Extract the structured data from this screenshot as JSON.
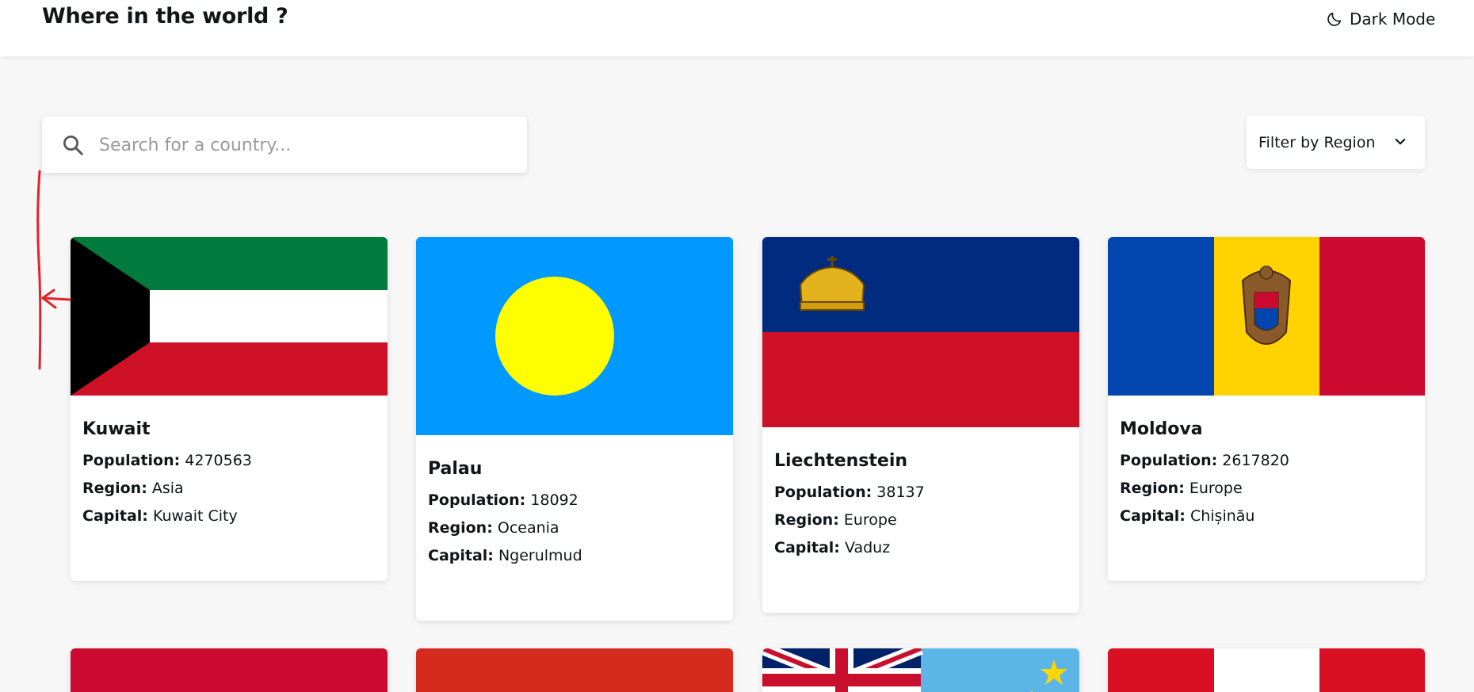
{
  "header": {
    "title": "Where in the world ?",
    "dark_mode_label": "Dark Mode",
    "dark_mode_icon": "moon-icon"
  },
  "search": {
    "placeholder": "Search for a country...",
    "value": "",
    "icon": "search-icon"
  },
  "filter": {
    "label": "Filter by Region",
    "icon": "chevron-down-icon"
  },
  "labels": {
    "population": "Population:",
    "region": "Region:",
    "capital": "Capital:"
  },
  "countries": [
    {
      "name": "Kuwait",
      "population": "4270563",
      "region": "Asia",
      "capital": "Kuwait City"
    },
    {
      "name": "Palau",
      "population": "18092",
      "region": "Oceania",
      "capital": "Ngerulmud"
    },
    {
      "name": "Liechtenstein",
      "population": "38137",
      "region": "Europe",
      "capital": "Vaduz"
    },
    {
      "name": "Moldova",
      "population": "2617820",
      "region": "Europe",
      "capital": "Chișinău"
    }
  ],
  "colors": {
    "background": "#f7f7f7",
    "card": "#ffffff",
    "text": "#111517",
    "annotation": "#e0242b"
  }
}
